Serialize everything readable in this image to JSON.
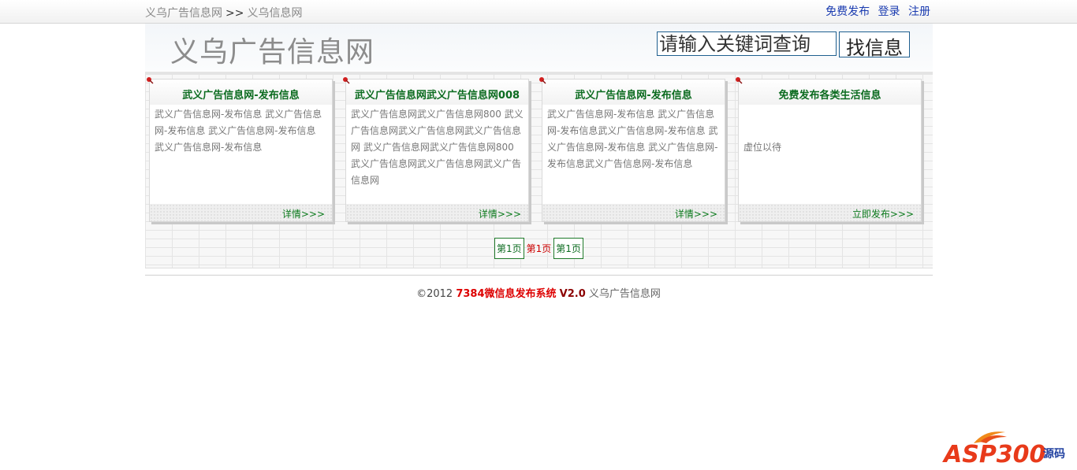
{
  "topbar": {
    "breadcrumb_home": "义乌广告信息网",
    "breadcrumb_sep": ">>",
    "breadcrumb_current": "义乌信息网",
    "links": [
      "免费发布",
      "登录",
      "注册"
    ]
  },
  "header": {
    "logo": "义乌广告信息网",
    "search_placeholder": "请输入关键词查询",
    "search_button": "找信息"
  },
  "cards": [
    {
      "title": "武义广告信息网-发布信息",
      "body": "武义广告信息网-发布信息 武义广告信息网-发布信息 武义广告信息网-发布信息 武义广告信息网-发布信息",
      "link": "详情>>>"
    },
    {
      "title": "武义广告信息网武义广告信息网008",
      "body": "武义广告信息网武义广告信息网800 武义广告信息网武义广告信息网武义广告信息网 武义广告信息网武义广告信息网800 武义广告信息网武义广告信息网武义广告信息网",
      "link": "详情>>>"
    },
    {
      "title": "武义广告信息网-发布信息",
      "body": "武义广告信息网-发布信息 武义广告信息网-发布信息武义广告信息网-发布信息 武义广告信息网-发布信息 武义广告信息网-发布信息武义广告信息网-发布信息",
      "link": "详情>>>"
    },
    {
      "title": "免费发布各类生活信息",
      "body": "虚位以待",
      "link": "立即发布>>>"
    }
  ],
  "pager": {
    "first": "第1页",
    "current": "第1页",
    "last": "第1页"
  },
  "footer": {
    "copyright": "©2012",
    "brand": "7384微信息发布系统",
    "version": "V2.0",
    "site": "义乌广告信息网"
  },
  "watermark": {
    "text": "ASP300",
    "tag": "源码"
  },
  "colors": {
    "title_green": "#0b6b1f",
    "link_blue": "#1a3bb0",
    "brand_red": "#dd0000"
  }
}
